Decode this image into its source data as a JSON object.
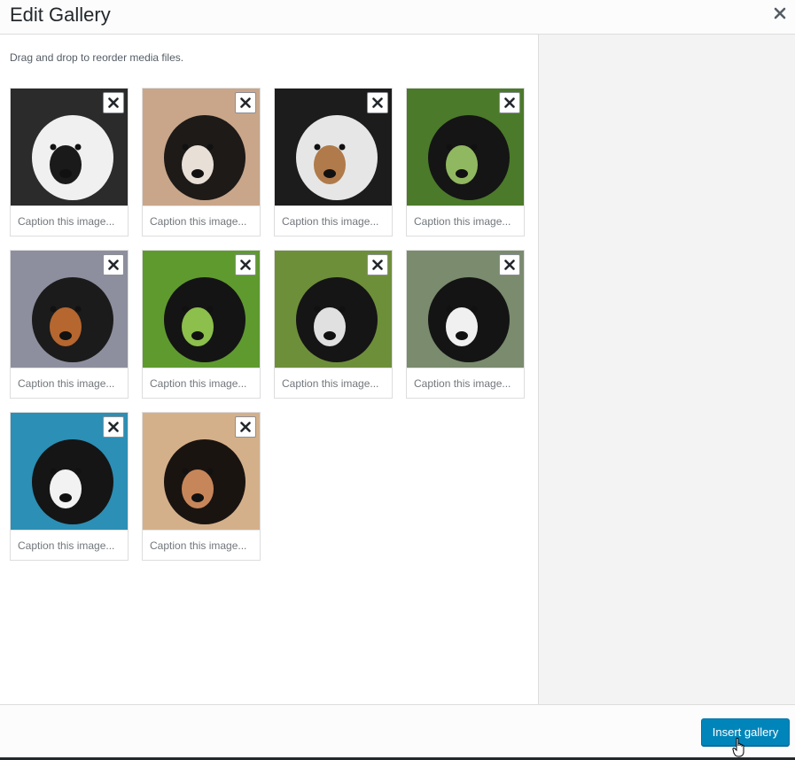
{
  "header": {
    "title": "Edit Gallery"
  },
  "main": {
    "instructions": "Drag and drop to reorder media files."
  },
  "gallery": {
    "items": [
      {
        "caption_placeholder": "Caption this image...",
        "colors": [
          "#2b2b2b",
          "#f0f0f0",
          "#1a1a1a"
        ]
      },
      {
        "caption_placeholder": "Caption this image...",
        "colors": [
          "#c9a68a",
          "#1d1a18",
          "#e8dfd6"
        ]
      },
      {
        "caption_placeholder": "Caption this image...",
        "colors": [
          "#1c1c1c",
          "#e6e6e6",
          "#b07a4a"
        ]
      },
      {
        "caption_placeholder": "Caption this image...",
        "colors": [
          "#4b7a2a",
          "#151515",
          "#90b860"
        ]
      },
      {
        "caption_placeholder": "Caption this image...",
        "colors": [
          "#8d8f9e",
          "#1b1b1b",
          "#b5672f"
        ]
      },
      {
        "caption_placeholder": "Caption this image...",
        "colors": [
          "#5f9a2f",
          "#141414",
          "#8cbf4c"
        ]
      },
      {
        "caption_placeholder": "Caption this image...",
        "colors": [
          "#6e8f3a",
          "#151515",
          "#e0e0e0"
        ]
      },
      {
        "caption_placeholder": "Caption this image...",
        "colors": [
          "#7a8b6e",
          "#141414",
          "#f0f0f0"
        ]
      },
      {
        "caption_placeholder": "Caption this image...",
        "colors": [
          "#2c8fb5",
          "#151515",
          "#f2f2f2"
        ]
      },
      {
        "caption_placeholder": "Caption this image...",
        "colors": [
          "#d4b08a",
          "#1a1411",
          "#c7865a"
        ]
      }
    ]
  },
  "footer": {
    "insert_label": "Insert gallery"
  },
  "colors": {
    "primary_button": "#0085ba",
    "sidebar_bg": "#f3f3f3",
    "border": "#dddddd"
  }
}
